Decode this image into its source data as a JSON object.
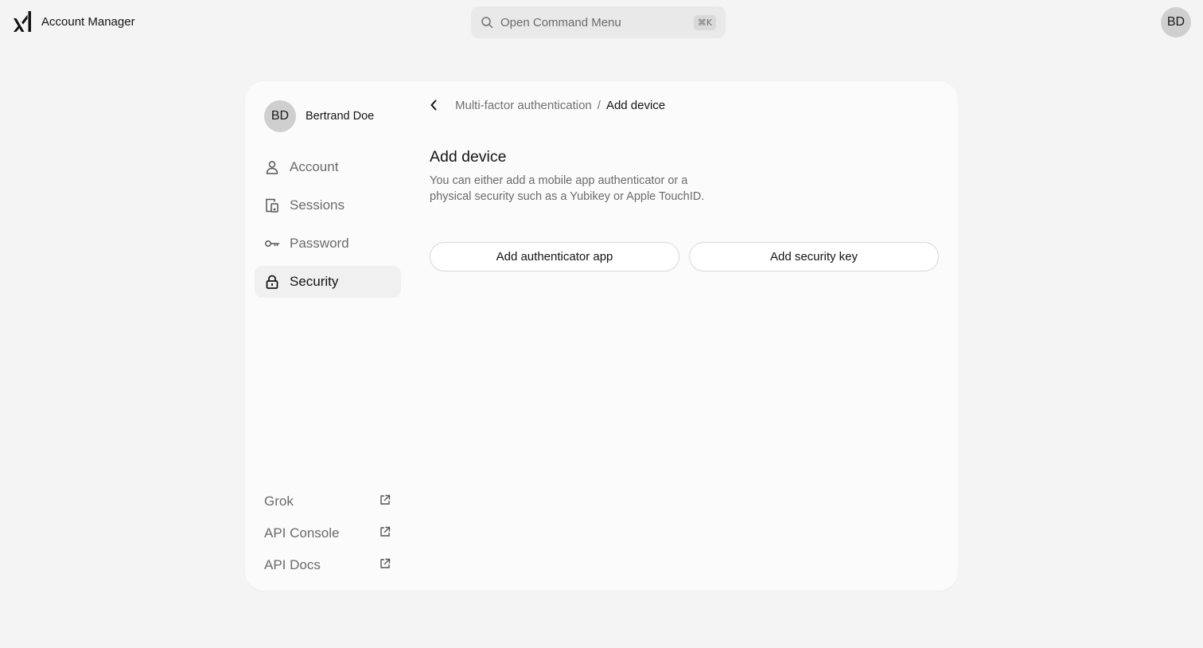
{
  "app": {
    "name": "Account Manager",
    "logo": "xai-logo"
  },
  "command_menu": {
    "placeholder": "Open Command Menu",
    "shortcut": "⌘K",
    "icon": "search-icon"
  },
  "header_user": {
    "initials": "BD"
  },
  "sidebar": {
    "user": {
      "initials": "BD",
      "name": "Bertrand Doe"
    },
    "items": [
      {
        "label": "Account",
        "icon": "user-icon",
        "active": false
      },
      {
        "label": "Sessions",
        "icon": "devices-icon",
        "active": false
      },
      {
        "label": "Password",
        "icon": "key-icon",
        "active": false
      },
      {
        "label": "Security",
        "icon": "lock-icon",
        "active": true
      }
    ],
    "external_links": [
      {
        "label": "Grok",
        "icon": "external-link-icon"
      },
      {
        "label": "API Console",
        "icon": "external-link-icon"
      },
      {
        "label": "API Docs",
        "icon": "external-link-icon"
      }
    ]
  },
  "breadcrumb": {
    "parent": "Multi-factor authentication",
    "separator": "/",
    "current": "Add device"
  },
  "content": {
    "title": "Add device",
    "description": "You can either add a mobile app authenticator or a physical security such as a Yubikey or Apple TouchID.",
    "buttons": {
      "authenticator": "Add authenticator app",
      "security_key": "Add security key"
    }
  }
}
